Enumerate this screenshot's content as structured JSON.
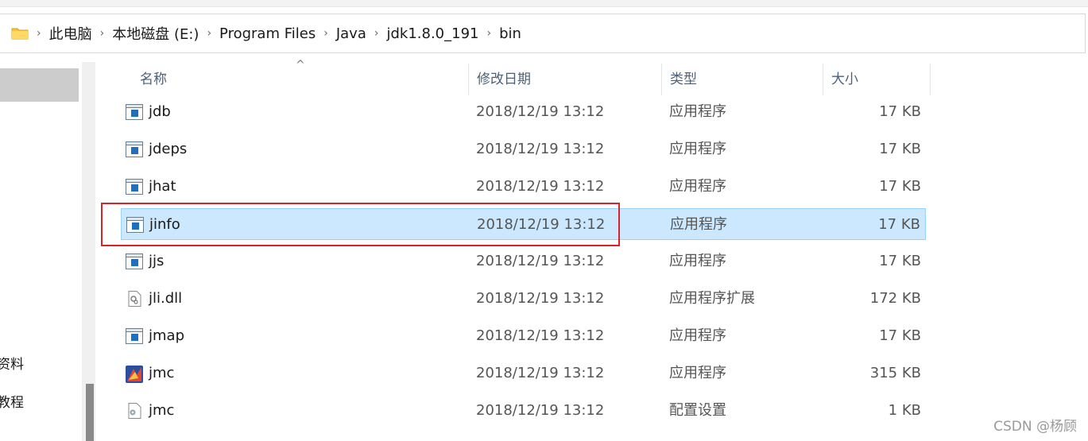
{
  "breadcrumb": {
    "items": [
      "此电脑",
      "本地磁盘 (E:)",
      "Program Files",
      "Java",
      "jdk1.8.0_191",
      "bin"
    ]
  },
  "nav": {
    "items": [
      "资料",
      "教程"
    ]
  },
  "columns": {
    "name": "名称",
    "date": "修改日期",
    "type": "类型",
    "size": "大小"
  },
  "files": [
    {
      "name": "jdb",
      "date": "2018/12/19 13:12",
      "type": "应用程序",
      "size": "17 KB",
      "icon": "exe-icon"
    },
    {
      "name": "jdeps",
      "date": "2018/12/19 13:12",
      "type": "应用程序",
      "size": "17 KB",
      "icon": "exe-icon"
    },
    {
      "name": "jhat",
      "date": "2018/12/19 13:12",
      "type": "应用程序",
      "size": "17 KB",
      "icon": "exe-icon"
    },
    {
      "name": "jinfo",
      "date": "2018/12/19 13:12",
      "type": "应用程序",
      "size": "17 KB",
      "icon": "exe-icon",
      "selected": true
    },
    {
      "name": "jjs",
      "date": "2018/12/19 13:12",
      "type": "应用程序",
      "size": "17 KB",
      "icon": "exe-icon"
    },
    {
      "name": "jli.dll",
      "date": "2018/12/19 13:12",
      "type": "应用程序扩展",
      "size": "172 KB",
      "icon": "dll-icon"
    },
    {
      "name": "jmap",
      "date": "2018/12/19 13:12",
      "type": "应用程序",
      "size": "17 KB",
      "icon": "exe-icon"
    },
    {
      "name": "jmc",
      "date": "2018/12/19 13:12",
      "type": "应用程序",
      "size": "315 KB",
      "icon": "jmc-icon"
    },
    {
      "name": "jmc",
      "date": "2018/12/19 13:12",
      "type": "配置设置",
      "size": "1 KB",
      "icon": "config-icon"
    }
  ],
  "colors": {
    "selection_bg": "#cce8ff",
    "selection_border": "#99d1ff",
    "highlight": "#d9232a",
    "header_text": "#4c607a"
  },
  "watermark": "CSDN @杨顾"
}
